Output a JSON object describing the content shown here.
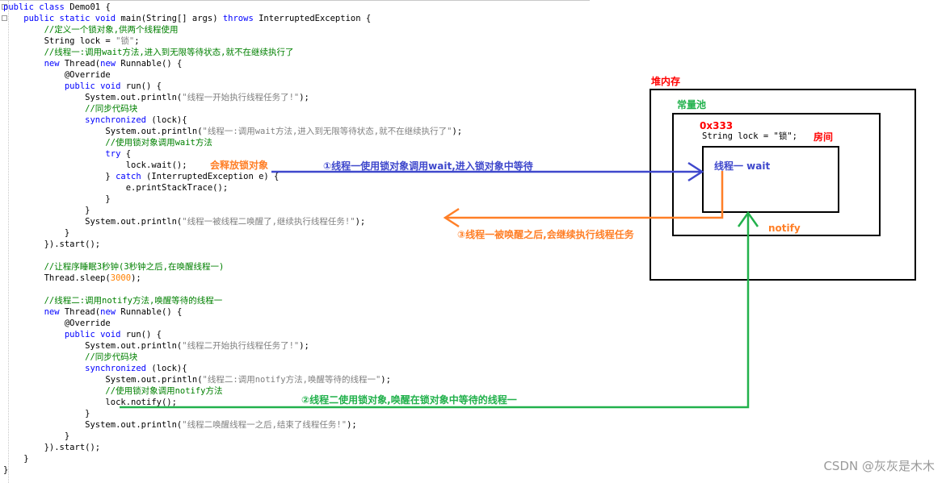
{
  "code": {
    "lines": [
      [
        {
          "t": "public class ",
          "c": "kw"
        },
        {
          "t": "Demo01 {",
          "c": ""
        }
      ],
      [
        {
          "t": "    public static void ",
          "c": "kw"
        },
        {
          "t": "main(String[] args) ",
          "c": ""
        },
        {
          "t": "throws ",
          "c": "kw"
        },
        {
          "t": "InterruptedException {",
          "c": ""
        }
      ],
      [
        {
          "t": "        //定义一个锁对象,供两个线程使用",
          "c": "cm"
        }
      ],
      [
        {
          "t": "        String lock = ",
          "c": ""
        },
        {
          "t": "\"锁\"",
          "c": "st"
        },
        {
          "t": ";",
          "c": ""
        }
      ],
      [
        {
          "t": "        //线程一:调用wait方法,进入到无限等待状态,就不在继续执行了",
          "c": "cm"
        }
      ],
      [
        {
          "t": "        new ",
          "c": "kw"
        },
        {
          "t": "Thread(",
          "c": ""
        },
        {
          "t": "new ",
          "c": "kw"
        },
        {
          "t": "Runnable() {",
          "c": ""
        }
      ],
      [
        {
          "t": "            @Override",
          "c": ""
        }
      ],
      [
        {
          "t": "            public void ",
          "c": "kw"
        },
        {
          "t": "run() {",
          "c": ""
        }
      ],
      [
        {
          "t": "                System.out.println(",
          "c": ""
        },
        {
          "t": "\"线程一开始执行线程任务了!\"",
          "c": "st"
        },
        {
          "t": ");",
          "c": ""
        }
      ],
      [
        {
          "t": "                //同步代码块",
          "c": "cm"
        }
      ],
      [
        {
          "t": "                synchronized ",
          "c": "kw"
        },
        {
          "t": "(lock){",
          "c": ""
        }
      ],
      [
        {
          "t": "                    System.out.println(",
          "c": ""
        },
        {
          "t": "\"线程一:调用wait方法,进入到无限等待状态,就不在继续执行了\"",
          "c": "st"
        },
        {
          "t": ");",
          "c": ""
        }
      ],
      [
        {
          "t": "                    //使用锁对象调用wait方法",
          "c": "cm"
        }
      ],
      [
        {
          "t": "                    try ",
          "c": "kw"
        },
        {
          "t": "{",
          "c": ""
        }
      ],
      [
        {
          "t": "                        lock.wait();",
          "c": ""
        }
      ],
      [
        {
          "t": "                    } ",
          "c": ""
        },
        {
          "t": "catch ",
          "c": "kw"
        },
        {
          "t": "(InterruptedException e) {",
          "c": ""
        }
      ],
      [
        {
          "t": "                        e.printStackTrace();",
          "c": ""
        }
      ],
      [
        {
          "t": "                    }",
          "c": ""
        }
      ],
      [
        {
          "t": "                }",
          "c": ""
        }
      ],
      [
        {
          "t": "                System.out.println(",
          "c": ""
        },
        {
          "t": "\"线程一被线程二唤醒了,继续执行线程任务!\"",
          "c": "st"
        },
        {
          "t": ");",
          "c": ""
        }
      ],
      [
        {
          "t": "            }",
          "c": ""
        }
      ],
      [
        {
          "t": "        }).start();",
          "c": ""
        }
      ],
      [
        {
          "t": "",
          "c": ""
        }
      ],
      [
        {
          "t": "        //让程序睡眠3秒钟(3秒钟之后,在唤醒线程一)",
          "c": "cm"
        }
      ],
      [
        {
          "t": "        Thread.sleep(",
          "c": ""
        },
        {
          "t": "3000",
          "c": "nm"
        },
        {
          "t": ");",
          "c": ""
        }
      ],
      [
        {
          "t": "",
          "c": ""
        }
      ],
      [
        {
          "t": "        //线程二:调用notify方法,唤醒等待的线程一",
          "c": "cm"
        }
      ],
      [
        {
          "t": "        new ",
          "c": "kw"
        },
        {
          "t": "Thread(",
          "c": ""
        },
        {
          "t": "new ",
          "c": "kw"
        },
        {
          "t": "Runnable() {",
          "c": ""
        }
      ],
      [
        {
          "t": "            @Override",
          "c": ""
        }
      ],
      [
        {
          "t": "            public void ",
          "c": "kw"
        },
        {
          "t": "run() {",
          "c": ""
        }
      ],
      [
        {
          "t": "                System.out.println(",
          "c": ""
        },
        {
          "t": "\"线程二开始执行线程任务了!\"",
          "c": "st"
        },
        {
          "t": ");",
          "c": ""
        }
      ],
      [
        {
          "t": "                //同步代码块",
          "c": "cm"
        }
      ],
      [
        {
          "t": "                synchronized ",
          "c": "kw"
        },
        {
          "t": "(lock){",
          "c": ""
        }
      ],
      [
        {
          "t": "                    System.out.println(",
          "c": ""
        },
        {
          "t": "\"线程二:调用notify方法,唤醒等待的线程一\"",
          "c": "st"
        },
        {
          "t": ");",
          "c": ""
        }
      ],
      [
        {
          "t": "                    //使用锁对象调用notify方法",
          "c": "cm"
        }
      ],
      [
        {
          "t": "                    lock.notify();",
          "c": ""
        }
      ],
      [
        {
          "t": "                }",
          "c": ""
        }
      ],
      [
        {
          "t": "                System.out.println(",
          "c": ""
        },
        {
          "t": "\"线程二唤醒线程一之后,结束了线程任务!\"",
          "c": "st"
        },
        {
          "t": ");",
          "c": ""
        }
      ],
      [
        {
          "t": "            }",
          "c": ""
        }
      ],
      [
        {
          "t": "        }).start();",
          "c": ""
        }
      ],
      [
        {
          "t": "    }",
          "c": ""
        }
      ],
      [
        {
          "t": "}",
          "c": ""
        }
      ]
    ]
  },
  "annotations": {
    "release_lock": "会释放锁对象",
    "step1": "①线程一使用锁对象调用wait,进入锁对象中等待",
    "step2": "②线程二使用锁对象,唤醒在锁对象中等待的线程一",
    "step3": "③线程一被唤醒之后,会继续执行线程任务",
    "notify": "notify"
  },
  "memory": {
    "heap_label": "堆内存",
    "pool_label": "常量池",
    "address": "0x333",
    "lock_decl": "String lock = \"锁\";",
    "room_label": "房间",
    "thread_label": "线程一 wait"
  },
  "watermark": "CSDN @灰灰是木木",
  "colors": {
    "keyword": "#0000ff",
    "comment": "#008000",
    "string": "#808080",
    "number": "#ff8000",
    "annotation_orange": "#ff7f27",
    "annotation_blue": "#3f48cc",
    "annotation_green": "#22b14c",
    "heap_red": "#ff0000",
    "pool_green": "#22b14c"
  }
}
